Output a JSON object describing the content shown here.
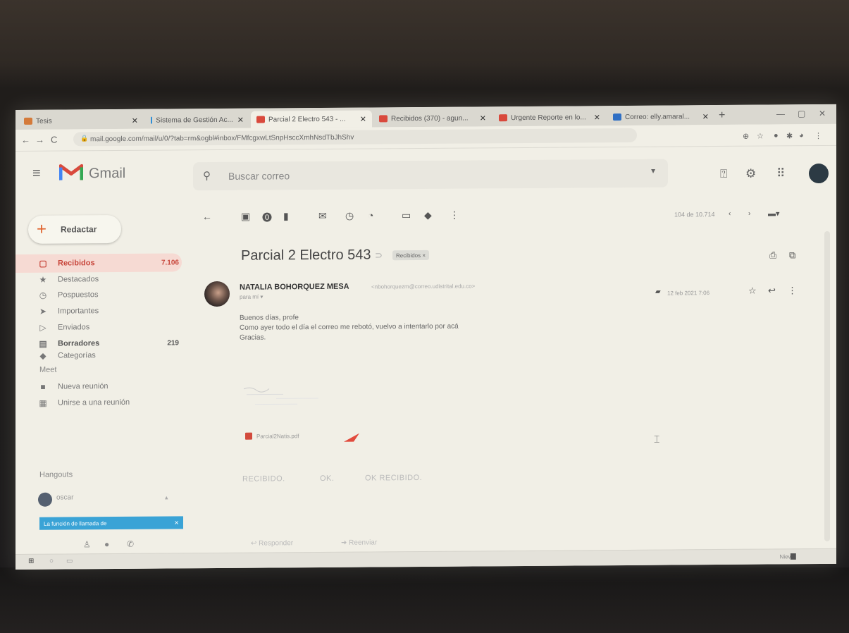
{
  "tabs": [
    {
      "label": "Tesis",
      "color": "#d47a3a"
    },
    {
      "label": "Sistema de Gestión Ac...",
      "color": "#2f8fd6"
    },
    {
      "label": "Parcial 2 Electro 543 - ...",
      "color": "#d9493c"
    },
    {
      "label": "Recibidos (370) - agun...",
      "color": "#d9493c"
    },
    {
      "label": "Urgente Reporte en lo...",
      "color": "#d9493c"
    },
    {
      "label": "Correo: elly.amaral...",
      "color": "#2f6fc4"
    }
  ],
  "browser": {
    "url": "mail.google.com/mail/u/0/?tab=rm&ogbl#inbox/FMfcgxwLtSnpHsccXmhNsdTbJhShv"
  },
  "gmail": {
    "brand": "Gmail",
    "search_placeholder": "Buscar correo",
    "compose_label": "Redactar"
  },
  "sidebar": {
    "items": [
      {
        "label": "Recibidos",
        "count": "7.106",
        "icon": "inbox-icon",
        "glyph": "▢"
      },
      {
        "label": "Destacados",
        "count": "",
        "icon": "star-icon",
        "glyph": "★"
      },
      {
        "label": "Pospuestos",
        "count": "",
        "icon": "clock-icon",
        "glyph": "◷"
      },
      {
        "label": "Importantes",
        "count": "",
        "icon": "important-icon",
        "glyph": "➤"
      },
      {
        "label": "Enviados",
        "count": "",
        "icon": "send-icon",
        "glyph": "▷"
      },
      {
        "label": "Borradores",
        "count": "219",
        "icon": "draft-icon",
        "glyph": "▤"
      },
      {
        "label": "Categorías",
        "count": "",
        "icon": "label-icon",
        "glyph": "◆"
      }
    ],
    "meet_header": "Meet",
    "meet_items": [
      {
        "label": "Nueva reunión",
        "icon": "video-icon"
      },
      {
        "label": "Unirse a una reunión",
        "icon": "keyboard-icon"
      }
    ],
    "hangouts_header": "Hangouts",
    "hangouts_user": "oscar",
    "chat_notice": "La función de llamada de"
  },
  "toolbar": {
    "pager": "104 de 10.714"
  },
  "message": {
    "subject": "Parcial 2 Electro 543",
    "label": "Recibidos ×",
    "sender_name": "NATALIA BOHORQUEZ MESA",
    "sender_email": "<nbohorquezm@correo.udistrital.edu.co>",
    "to": "para mí ▾",
    "date": "12 feb 2021 7:06",
    "body": [
      "Buenos días, profe",
      "Como ayer todo el día el correo me rebotó, vuelvo a intentarlo por acá",
      "Gracias."
    ],
    "attachment": "Parcial2Natis.pdf",
    "smart_replies": [
      "RECIBIDO.",
      "OK.",
      "OK RECIBIDO."
    ],
    "reply_label": "Responder",
    "forward_label": "Reenviar"
  },
  "taskbar": {
    "tray_text": "Nieve"
  },
  "colors": {
    "accent_red": "#c8473c",
    "chat_blue": "#3aa3d6"
  }
}
